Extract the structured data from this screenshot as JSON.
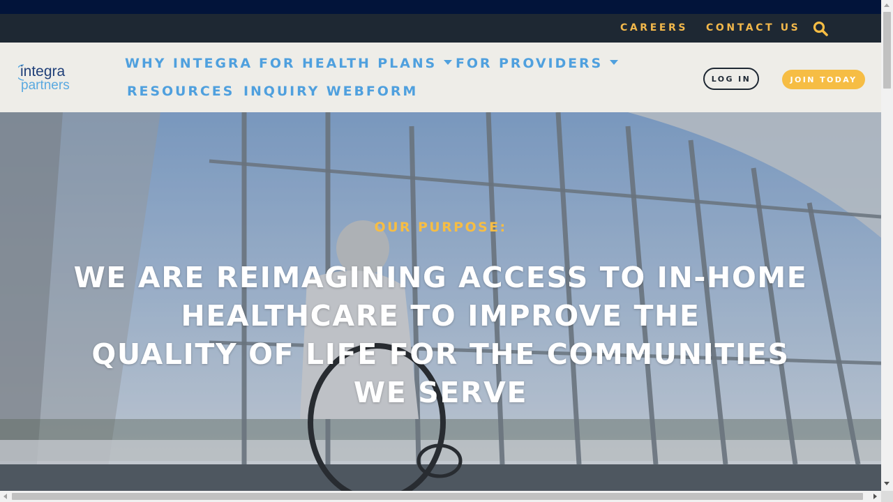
{
  "utility_nav": {
    "links": [
      {
        "label": "CAREERS"
      },
      {
        "label": "CONTACT US"
      }
    ],
    "search_icon": "search-icon"
  },
  "header": {
    "logo": {
      "line1": "integra",
      "line2": "partners"
    },
    "nav": {
      "why_integra": "WHY INTEGRA",
      "for_health_plans": "FOR HEALTH PLANS",
      "for_providers": "FOR PROVIDERS",
      "resources": "RESOURCES",
      "inquiry_webform": "INQUIRY WEBFORM"
    },
    "buttons": {
      "login": "LOG IN",
      "join": "JOIN TODAY"
    }
  },
  "hero": {
    "label": "OUR PURPOSE:",
    "headline_lines": [
      "WE ARE REIMAGINING ACCESS TO IN-HOME",
      "HEALTHCARE TO IMPROVE THE",
      "QUALITY OF LIFE FOR THE COMMUNITIES",
      "WE SERVE"
    ]
  },
  "colors": {
    "top_strip": "#02143a",
    "utility_bar": "#1e2833",
    "accent_gold": "#f6bd44",
    "nav_blue": "#4fa0de",
    "header_bg": "#eeede8",
    "logo_navy": "#1f3f78",
    "logo_light_blue": "#5aa9e0"
  }
}
